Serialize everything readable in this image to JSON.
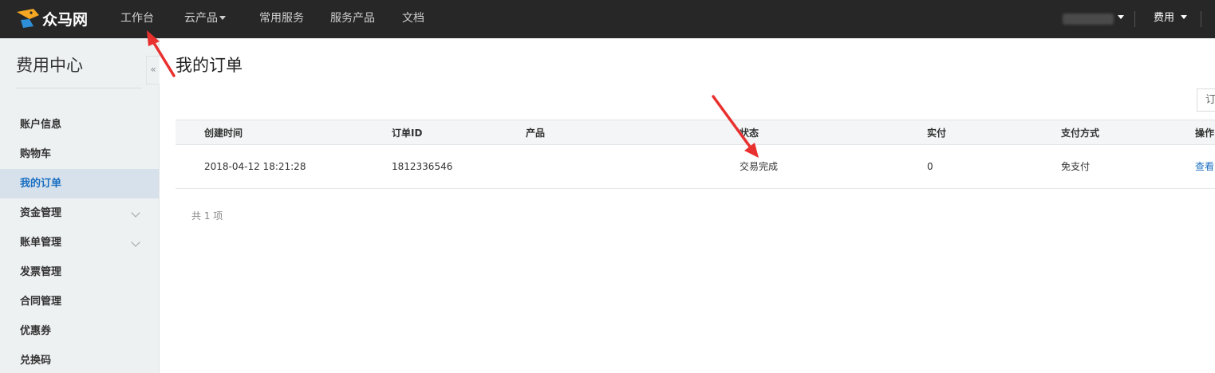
{
  "topbar": {
    "logo_text": "众马网",
    "nav": [
      "工作台",
      "云产品",
      "常用服务",
      "服务产品",
      "文档"
    ],
    "fee_menu": "费用"
  },
  "sidebar": {
    "title": "费用中心",
    "collapse_glyph": "«",
    "items": [
      {
        "label": "账户信息"
      },
      {
        "label": "购物车"
      },
      {
        "label": "我的订单",
        "active": true
      },
      {
        "label": "资金管理",
        "expandable": true
      },
      {
        "label": "账单管理",
        "expandable": true
      },
      {
        "label": "发票管理"
      },
      {
        "label": "合同管理"
      },
      {
        "label": "优惠券"
      },
      {
        "label": "兑换码"
      }
    ]
  },
  "main": {
    "title": "我的订单",
    "filter_placeholder": "订",
    "table": {
      "headers": [
        "创建时间",
        "订单ID",
        "产品",
        "状态",
        "实付",
        "支付方式",
        "操作"
      ],
      "rows": [
        [
          "2018-04-12 18:21:28",
          "1812336546",
          "",
          "交易完成",
          "0",
          "免支付",
          "查看"
        ]
      ]
    },
    "total_text": "共 1 项"
  },
  "colors": {
    "topbar": "#272727",
    "sidebar": "#eef1f2",
    "active_item": "#d6e1eb",
    "link": "#1a6fc1",
    "annotation": "#e8312f"
  }
}
